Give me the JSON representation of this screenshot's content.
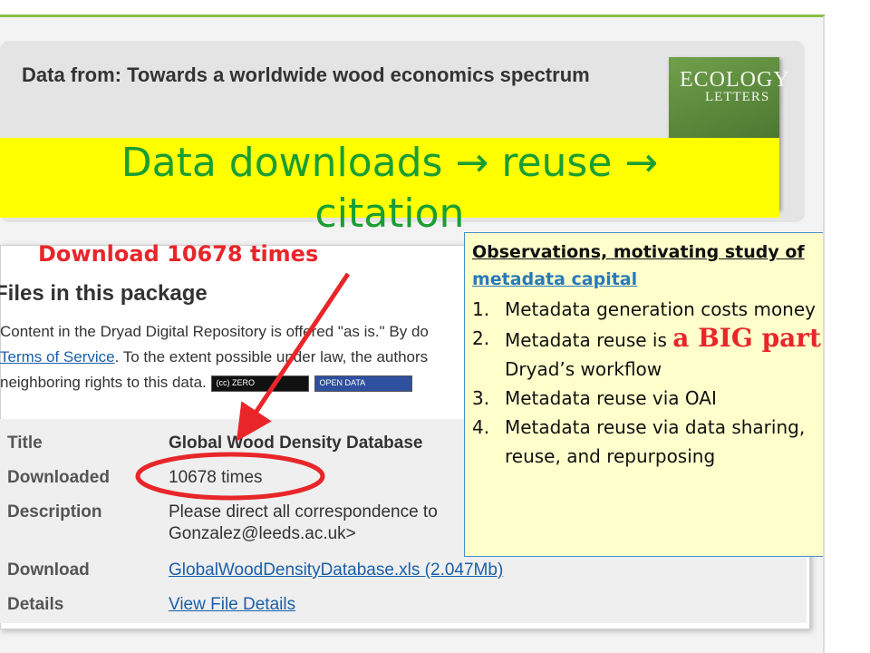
{
  "page_header": {
    "title": "Data from: Towards a worldwide wood economics spectrum",
    "journal_cover": {
      "line1": "ECOLOGY",
      "line2": "LETTERS"
    }
  },
  "banner": {
    "line1": "Data downloads → reuse →",
    "line2": "citation"
  },
  "annotation": {
    "download_label": "Download 10678 times"
  },
  "files_section": {
    "heading": "Files in this package",
    "text_line1": "Content in the Dryad Digital Repository is offered \"as is.\" By do",
    "link_terms": "Terms of Service",
    "text_line2_rest": ". To the extent possible under law, the authors",
    "text_line3": "neighboring rights to this data.",
    "badge_cc": "(cc) ZERO",
    "badge_od": "OPEN DATA"
  },
  "file_meta": {
    "title_key": "Title",
    "title_value": "Global Wood Density Database",
    "downloaded_key": "Downloaded",
    "downloaded_value": "10678 times",
    "description_key": "Description",
    "description_line1": "Please direct all correspondence to",
    "description_line2": "Gonzalez@leeds.ac.uk>",
    "download_key": "Download",
    "download_value": "GlobalWoodDensityDatabase.xls (2.047Mb)",
    "details_key": "Details",
    "details_value": "View File Details"
  },
  "observations": {
    "heading_prefix": "Observations, motivating study of ",
    "heading_link": "metadata capital",
    "items": [
      {
        "num": "1.",
        "text": "Metadata generation costs money"
      },
      {
        "num": "2.",
        "pre": "Metadata reuse is ",
        "big": "a BIG part",
        "post": " of Dryad’s workflow"
      },
      {
        "num": "3.",
        "text": "Metadata reuse via OAI"
      },
      {
        "num": "4.",
        "text": "Metadata reuse via data sharing, reuse, and repurposing"
      }
    ]
  },
  "colors": {
    "banner_bg": "#ffff00",
    "banner_text": "#1a9e32",
    "annotation_red": "#e8262a",
    "link_blue": "#1b5fa8",
    "box_bg": "#ffffcc"
  }
}
